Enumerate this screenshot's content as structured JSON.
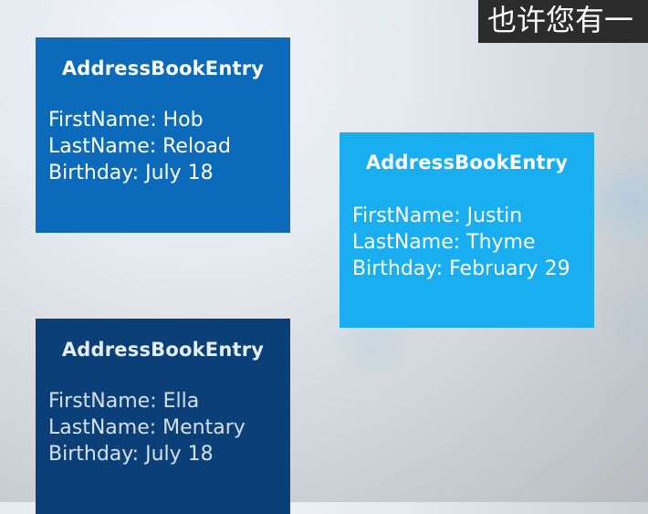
{
  "caption": "也许您有一",
  "cards": [
    {
      "title": "AddressBookEntry",
      "first": "FirstName: Hob",
      "last": "LastName: Reload",
      "birthday": "Birthday: July 18"
    },
    {
      "title": "AddressBookEntry",
      "first": "FirstName: Justin",
      "last": "LastName: Thyme",
      "birthday": "Birthday: February 29"
    },
    {
      "title": "AddressBookEntry",
      "first": "FirstName: Ella",
      "last": "LastName: Mentary",
      "birthday": "Birthday: July 18"
    }
  ],
  "colors": {
    "card_hob": "#0b6aba",
    "card_justin": "#19aef0",
    "card_ella": "#0a3f78",
    "caption_bg": "#2c2c2c"
  }
}
